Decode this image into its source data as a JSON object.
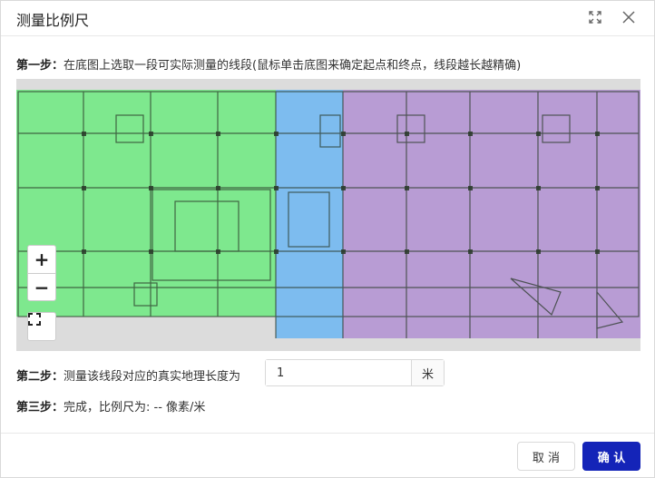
{
  "dialog": {
    "title": "测量比例尺",
    "maximize_icon": "maximize-icon",
    "close_icon": "close-icon"
  },
  "steps": {
    "step1_label": "第一步：",
    "step1_text": "在底图上选取一段可实际测量的线段(鼠标单击底图来确定起点和终点，线段越长越精确)",
    "step2_label": "第二步：",
    "step2_text": "测量该线段对应的真实地理长度为",
    "step3_label": "第三步：",
    "step3_text": "完成，比例尺为: -- 像素/米"
  },
  "map": {
    "zoom_in": "+",
    "zoom_out": "−",
    "fullscreen_icon": "fullscreen-icon",
    "zones": [
      {
        "name": "green-zone",
        "color": "#7ee88e"
      },
      {
        "name": "blue-zone",
        "color": "#7dbcef"
      },
      {
        "name": "purple-zone",
        "color": "#b89cd4"
      }
    ],
    "background_color": "#dcdcdc"
  },
  "length_input": {
    "value": "1",
    "unit": "米"
  },
  "buttons": {
    "cancel": "取 消",
    "ok": "确 认"
  },
  "colors": {
    "primary": "#1424b8",
    "border": "#d9d9d9"
  }
}
